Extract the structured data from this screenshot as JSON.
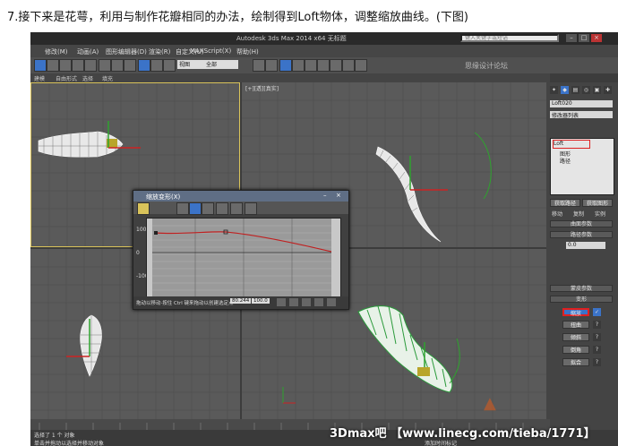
{
  "caption": "7.接下来是花萼，利用与制作花瓣相同的办法，绘制得到Loft物体，调整缩放曲线。(下图)",
  "window": {
    "title": "Autodesk 3ds Max  2014 x64    无标题",
    "search_placeholder": "键入关键字或短语",
    "site_watermark": "思缘设计论坛"
  },
  "menu": [
    "修改(M)",
    "动画(A)",
    "图形编辑器(D)",
    "渲染(R)",
    "自定义(U)",
    "MAXScript(X)",
    "帮助(H)"
  ],
  "toolbar": {
    "selection_set": "全部",
    "view_dropdown": "视图"
  },
  "ribbon": [
    "建模",
    "自由形式",
    "选择",
    "填充"
  ],
  "viewport_label": "[+][透][真实]",
  "command_panel": {
    "object_name": "Loft020",
    "modifier_list": "修改器列表",
    "loft_label": "Loft",
    "sub_path": "图形",
    "sub_shape": "路径",
    "sections": {
      "skin": "蒙皮参数",
      "surface": "曲面参数",
      "path": "路径参数",
      "deform": "变形"
    },
    "path_value": "0.0",
    "deform_buttons": [
      "缩放",
      "扭曲",
      "倾斜",
      "倒角",
      "拟合"
    ],
    "buttons": {
      "get_path": "获取路径",
      "get_shape": "获取图形",
      "move": "移动",
      "copy": "复制",
      "instance": "实例"
    }
  },
  "dialog": {
    "title": "缩放变形(X)",
    "y_labels": [
      "100",
      "0",
      "-100"
    ],
    "status_text": "拖动以移动·按住 Ctrl 键来拖动以创建选定点",
    "value1": "80.244",
    "value2": "100.0"
  },
  "status": {
    "selection": "选择了 1 个 对象",
    "hint": "单击并拖动以选择并移动对象",
    "add_time_tag": "添加时间标记"
  },
  "watermark_bottom": "3Dmax吧 【www.linecg.com/tieba/1771】",
  "colors": {
    "curve": "#c02020",
    "accent": "#3b73c8",
    "highlight": "#e02020"
  }
}
